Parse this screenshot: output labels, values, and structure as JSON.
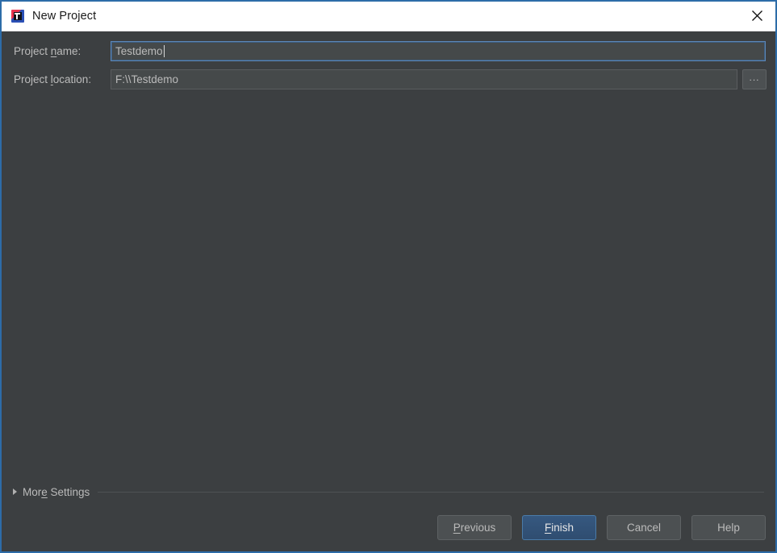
{
  "window": {
    "title": "New Project",
    "icon": "intellij-logo-icon",
    "close_icon": "close-icon",
    "border_color": "#2d6ca8",
    "background": "#3c3f41"
  },
  "form": {
    "rows": [
      {
        "label_before": "Project ",
        "label_mnemonic": "n",
        "label_after": "ame:",
        "value": "Testdemo",
        "focused": true,
        "has_browse": false
      },
      {
        "label_before": "Project ",
        "label_mnemonic": "l",
        "label_after": "ocation:",
        "value": "F:\\\\Testdemo",
        "focused": false,
        "has_browse": true,
        "browse_label": "..."
      }
    ],
    "name_label_full": "Project name:",
    "name_value": "Testdemo",
    "location_label_full": "Project location:",
    "location_value": "F:\\\\Testdemo",
    "browse_label": "..."
  },
  "more_settings": {
    "label_before": "Mor",
    "label_mnemonic": "e",
    "label_after": " Settings",
    "full_label": "More Settings",
    "expanded": false,
    "triangle_icon": "chevron-right-icon"
  },
  "buttons": [
    {
      "name": "previous-button",
      "before": "",
      "mnemonic": "P",
      "after": "revious",
      "full_label": "Previous",
      "default": false
    },
    {
      "name": "finish-button",
      "before": "",
      "mnemonic": "F",
      "after": "inish",
      "full_label": "Finish",
      "default": true
    },
    {
      "name": "cancel-button",
      "before": "Cancel",
      "mnemonic": "",
      "after": "",
      "full_label": "Cancel",
      "default": false
    },
    {
      "name": "help-button",
      "before": "Help",
      "mnemonic": "",
      "after": "",
      "full_label": "Help",
      "default": false
    }
  ],
  "colors": {
    "accent_blue": "#2d6ca8",
    "default_button_blue": "#365880",
    "panel_bg": "#3c3f41",
    "field_bg": "#45494a",
    "text": "#bbbbbb",
    "titlebar_bg": "#ffffff"
  }
}
